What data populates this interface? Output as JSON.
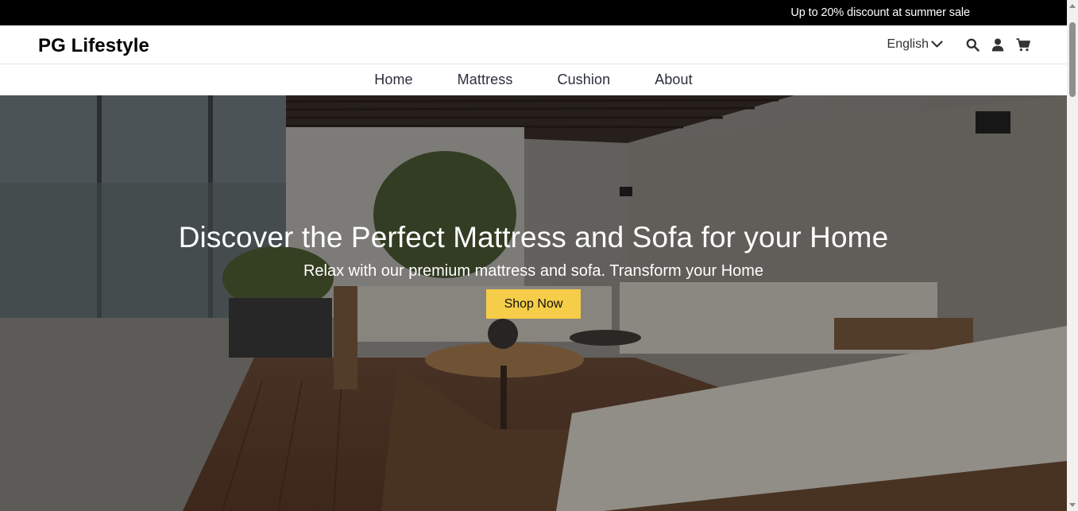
{
  "announcement": {
    "text": "Up to 20% discount at summer sale"
  },
  "header": {
    "logo": "PG Lifestyle",
    "language": {
      "selected": "English",
      "icon": "chevron-down-icon"
    },
    "icons": [
      "search-icon",
      "user-icon",
      "cart-icon"
    ]
  },
  "nav": {
    "items": [
      {
        "label": "Home"
      },
      {
        "label": "Mattress"
      },
      {
        "label": "Cushion"
      },
      {
        "label": "About"
      }
    ]
  },
  "hero": {
    "title": "Discover the Perfect Mattress and Sofa for your Home",
    "subtitle": "Relax with our premium mattress and sofa. Transform your Home",
    "cta_label": "Shop Now"
  },
  "colors": {
    "announcement_bg": "#000000",
    "cta_bg": "#f6cd48",
    "nav_text": "#2a2f3a"
  }
}
